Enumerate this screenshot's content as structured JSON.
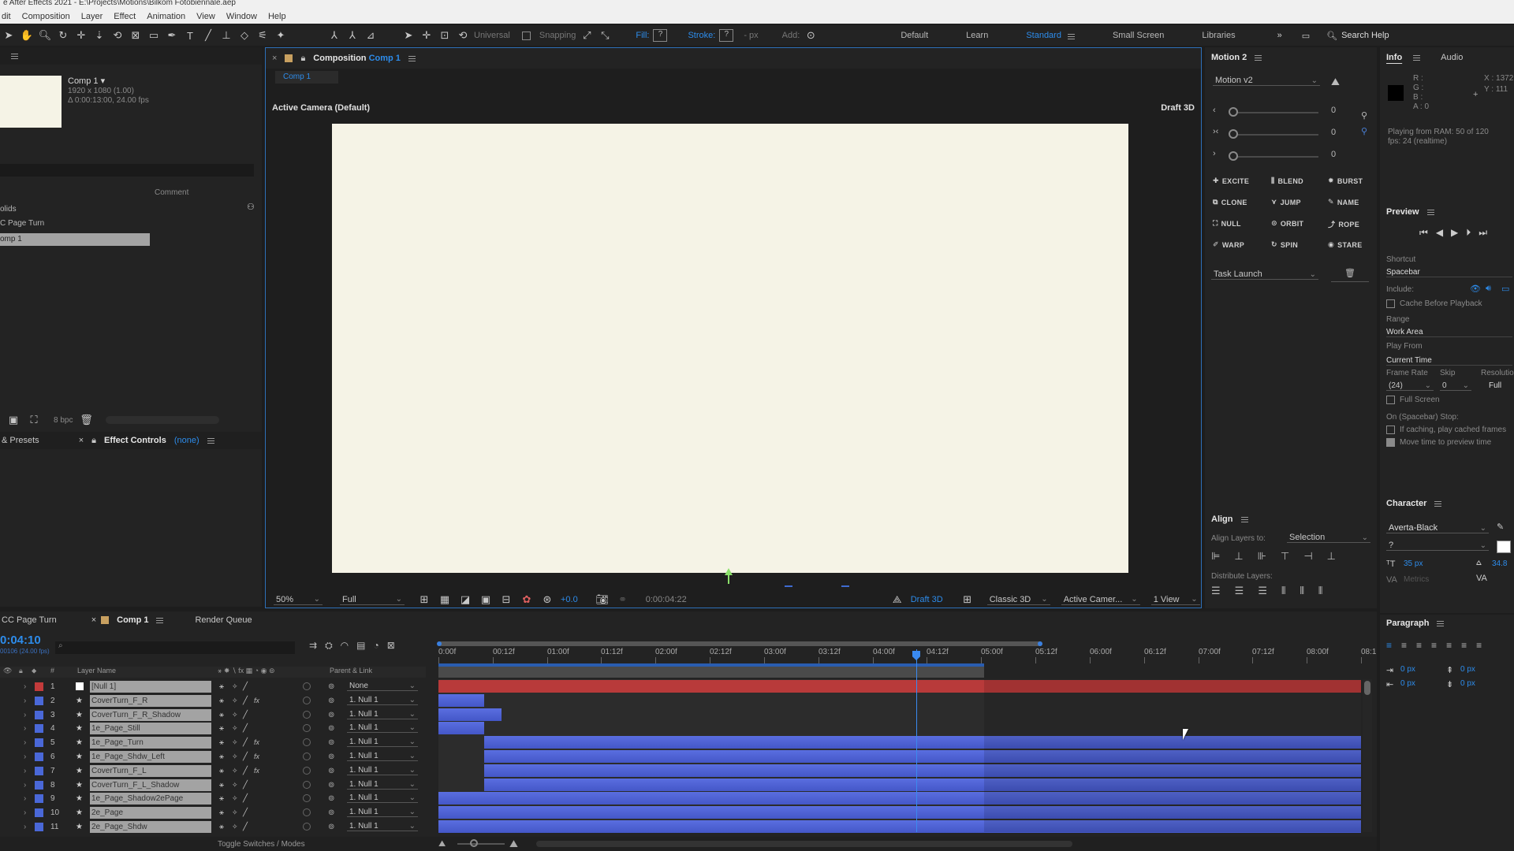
{
  "app": {
    "title": "e After Effects 2021 - E:\\Projects\\Motions\\Bilkom Fotobiennale.aep"
  },
  "menu": [
    "dit",
    "Composition",
    "Layer",
    "Effect",
    "Animation",
    "View",
    "Window",
    "Help"
  ],
  "toolbar": {
    "universal": "Universal",
    "snapping": "Snapping",
    "fill": "Fill:",
    "stroke": "Stroke:",
    "stroke_px": "- px",
    "add": "Add:",
    "workspaces": [
      "Default",
      "Learn",
      "Standard",
      "Small Screen",
      "Libraries"
    ],
    "active_workspace": "Standard",
    "search_help": "Search Help"
  },
  "project": {
    "comp_name": "Comp 1 ▾",
    "comp_res": "1920 x 1080 (1.00)",
    "comp_duration": "Δ 0:00:13:00, 24.00 fps",
    "col_comment": "Comment",
    "items": [
      "olids",
      "C Page Turn",
      "omp 1"
    ],
    "bpc": "8 bpc"
  },
  "effects_tabs": {
    "presets": "& Presets",
    "effect_controls": "Effect Controls",
    "effect_controls_none": "(none)"
  },
  "composition": {
    "tab_label": "Composition",
    "tab_comp": "Comp 1",
    "sub_tab": "Comp 1",
    "camera": "Active Camera (Default)",
    "draft": "Draft 3D",
    "zoom": "50%",
    "resolution": "Full",
    "exposure": "+0.0",
    "timecode": "0:00:04:22",
    "draft3d": "Draft 3D",
    "renderer": "Classic 3D",
    "camera_dd": "Active Camer...",
    "views": "1 View"
  },
  "motion": {
    "title": "Motion 2",
    "preset": "Motion v2",
    "slider_values": [
      "0",
      "0",
      "0"
    ],
    "buttons": [
      "EXCITE",
      "BLEND",
      "BURST",
      "CLONE",
      "JUMP",
      "NAME",
      "NULL",
      "ORBIT",
      "ROPE",
      "WARP",
      "SPIN",
      "STARE"
    ],
    "task": "Task Launch"
  },
  "align": {
    "title": "Align",
    "align_to_label": "Align Layers to:",
    "align_to": "Selection",
    "distribute": "Distribute Layers:"
  },
  "info": {
    "tab_info": "Info",
    "tab_audio": "Audio",
    "r": "R :",
    "g": "G :",
    "b": "B :",
    "a": "A : 0",
    "x": "X : 1372",
    "y": "Y : 111",
    "playing": "Playing from RAM: 50 of 120",
    "fps": "fps: 24 (realtime)"
  },
  "preview": {
    "title": "Preview",
    "shortcut_label": "Shortcut",
    "shortcut": "Spacebar",
    "include": "Include:",
    "cache": "Cache Before Playback",
    "range_label": "Range",
    "range": "Work Area",
    "play_from_label": "Play From",
    "play_from": "Current Time",
    "frame_rate_label": "Frame Rate",
    "skip_label": "Skip",
    "resolution_label": "Resolution",
    "frame_rate": "(24)",
    "skip": "0",
    "resolution": "Full",
    "full_screen": "Full Screen",
    "stop_label": "On (Spacebar) Stop:",
    "if_caching": "If caching, play cached frames",
    "move_time": "Move time to preview time"
  },
  "character": {
    "title": "Character",
    "font": "Averta-Black",
    "style": "?",
    "size": "35 px",
    "leading": "34.8",
    "metrics": "Metrics"
  },
  "paragraph": {
    "title": "Paragraph",
    "px1": "0 px",
    "px2": "0 px",
    "px3": "0 px",
    "px4": "0 px"
  },
  "timeline": {
    "tabs": [
      "CC Page Turn",
      "Comp 1",
      "Render Queue"
    ],
    "current_time": "0:04:10",
    "current_frames": "00106 (24.00 fps)",
    "col_layer": "Layer Name",
    "col_parent": "Parent & Link",
    "toggle": "Toggle Switches / Modes",
    "ruler": [
      "0:00f",
      "00:12f",
      "01:00f",
      "01:12f",
      "02:00f",
      "02:12f",
      "03:00f",
      "03:12f",
      "04:00f",
      "04:12f",
      "05:00f",
      "05:12f",
      "06:00f",
      "06:12f",
      "07:00f",
      "07:12f",
      "08:00f",
      "08:1"
    ],
    "playhead_seconds": 4.4,
    "work_area_end_seconds": 5.0,
    "total_seconds": 8.5,
    "layers": [
      {
        "num": "1",
        "name": "[Null 1]",
        "parent": "None",
        "color": "#c23b3b",
        "start": 0,
        "end": 8.5,
        "red": true,
        "fx": false
      },
      {
        "num": "2",
        "name": "CoverTurn_F_R",
        "parent": "1. Null 1",
        "color": "#4a68d8",
        "start": 0,
        "end": 0.42,
        "red": false,
        "fx": true
      },
      {
        "num": "3",
        "name": "CoverTurn_F_R_Shadow",
        "parent": "1. Null 1",
        "color": "#4a68d8",
        "start": 0,
        "end": 0.58,
        "red": false,
        "fx": false
      },
      {
        "num": "4",
        "name": "1e_Page_Still",
        "parent": "1. Null 1",
        "color": "#4a68d8",
        "start": 0,
        "end": 0.42,
        "red": false,
        "fx": false
      },
      {
        "num": "5",
        "name": "1e_Page_Turn",
        "parent": "1. Null 1",
        "color": "#4a68d8",
        "start": 0.42,
        "end": 8.5,
        "red": false,
        "fx": true
      },
      {
        "num": "6",
        "name": "1e_Page_Shdw_Left",
        "parent": "1. Null 1",
        "color": "#4a68d8",
        "start": 0.42,
        "end": 8.5,
        "red": false,
        "fx": true
      },
      {
        "num": "7",
        "name": "CoverTurn_F_L",
        "parent": "1. Null 1",
        "color": "#4a68d8",
        "start": 0.42,
        "end": 8.5,
        "red": false,
        "fx": true
      },
      {
        "num": "8",
        "name": "CoverTurn_F_L_Shadow",
        "parent": "1. Null 1",
        "color": "#4a68d8",
        "start": 0.42,
        "end": 8.5,
        "red": false,
        "fx": false
      },
      {
        "num": "9",
        "name": "1e_Page_Shadow2ePage",
        "parent": "1. Null 1",
        "color": "#4a68d8",
        "start": 0,
        "end": 8.5,
        "red": false,
        "fx": false
      },
      {
        "num": "10",
        "name": "2e_Page",
        "parent": "1. Null 1",
        "color": "#4a68d8",
        "start": 0,
        "end": 8.5,
        "red": false,
        "fx": false
      },
      {
        "num": "11",
        "name": "2e_Page_Shdw",
        "parent": "1. Null 1",
        "color": "#4a68d8",
        "start": 0,
        "end": 8.5,
        "red": false,
        "fx": false
      }
    ]
  },
  "colors": {
    "accent": "#2d8ceb",
    "canvas": "#f5f3e6",
    "bar": "#4a5ed0",
    "null_bar": "#b83a3a"
  }
}
